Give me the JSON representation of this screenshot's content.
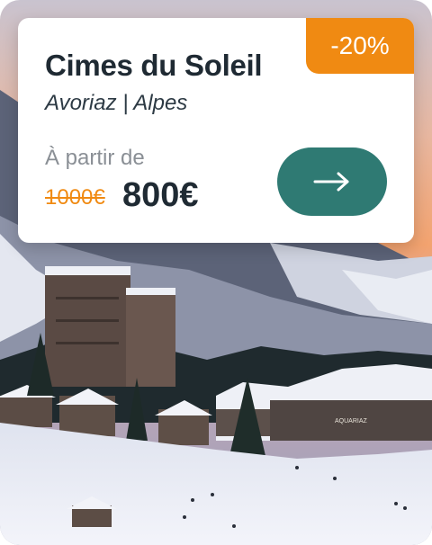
{
  "card": {
    "discount": "-20%",
    "title": "Cimes du Soleil",
    "location": "Avoriaz | Alpes",
    "from_label": "À partir de",
    "old_price": "1000€",
    "new_price": "800€",
    "button_icon": "arrow-right-icon",
    "sign_text": "AQUARIAZ"
  },
  "colors": {
    "accent_orange": "#f08a12",
    "button_teal": "#2f7a73",
    "title_dark": "#1f2a33"
  }
}
